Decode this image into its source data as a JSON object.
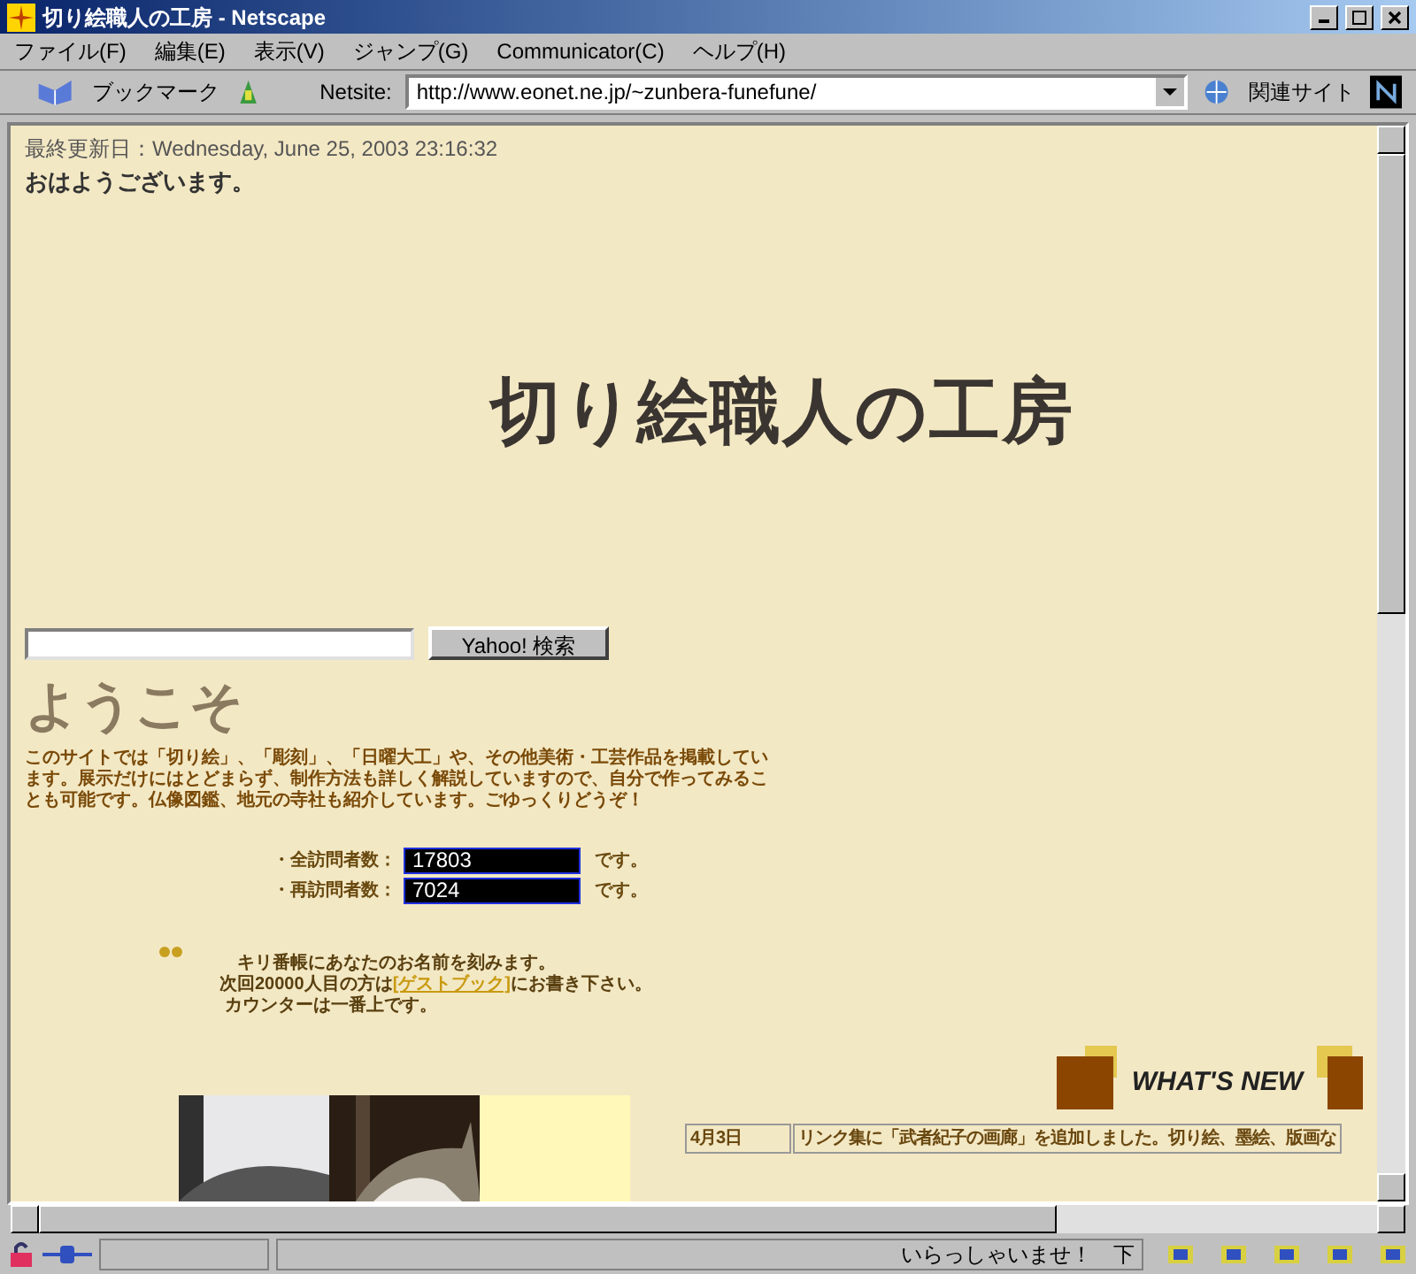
{
  "window": {
    "title": "切り絵職人の工房 - Netscape"
  },
  "menu": [
    "ファイル(F)",
    "編集(E)",
    "表示(V)",
    "ジャンプ(G)",
    "Communicator(C)",
    "ヘルプ(H)"
  ],
  "toolbar": {
    "bookmarks": "ブックマーク",
    "location_label": "Netsite:",
    "url": "http://www.eonet.ne.jp/~zunbera-funefune/",
    "related": "関連サイト"
  },
  "page": {
    "updated": "最終更新日：Wednesday, June 25, 2003 23:16:32",
    "greeting": "おはようございます。",
    "logo": "切り絵職人の工房",
    "search_button": "Yahoo! 検索",
    "welcome": "ようこそ",
    "intro": "このサイトでは「切り絵」、「彫刻」、「日曜大工」や、その他美術・工芸作品を掲載しています。展示だけにはとどまらず、制作方法も詳しく解説していますので、自分で作ってみることも可能です。仏像図鑑、地元の寺社も紹介しています。ごゆっくりどうぞ！",
    "counters": [
      {
        "label": "・全訪問者数：",
        "value": "17803",
        "suffix": "です。"
      },
      {
        "label": "・再訪問者数：",
        "value": "7024",
        "suffix": "です。"
      }
    ],
    "kiriban": {
      "line1": "キリ番帳にあなたのお名前を刻みます。",
      "line2_before": "次回20000人目の方は",
      "link": "[ゲストブック]",
      "line2_after": "にお書き下さい。",
      "line3": "カウンターは一番上です。"
    },
    "whats_new": "WHAT'S NEW",
    "news": [
      {
        "date": "4月3日",
        "text": "リンク集に「武者紀子の画廊」を追加しました。切り絵、墨絵、版画な"
      }
    ]
  },
  "status_bar": {
    "message": "いらっしゃいませ！　下"
  }
}
